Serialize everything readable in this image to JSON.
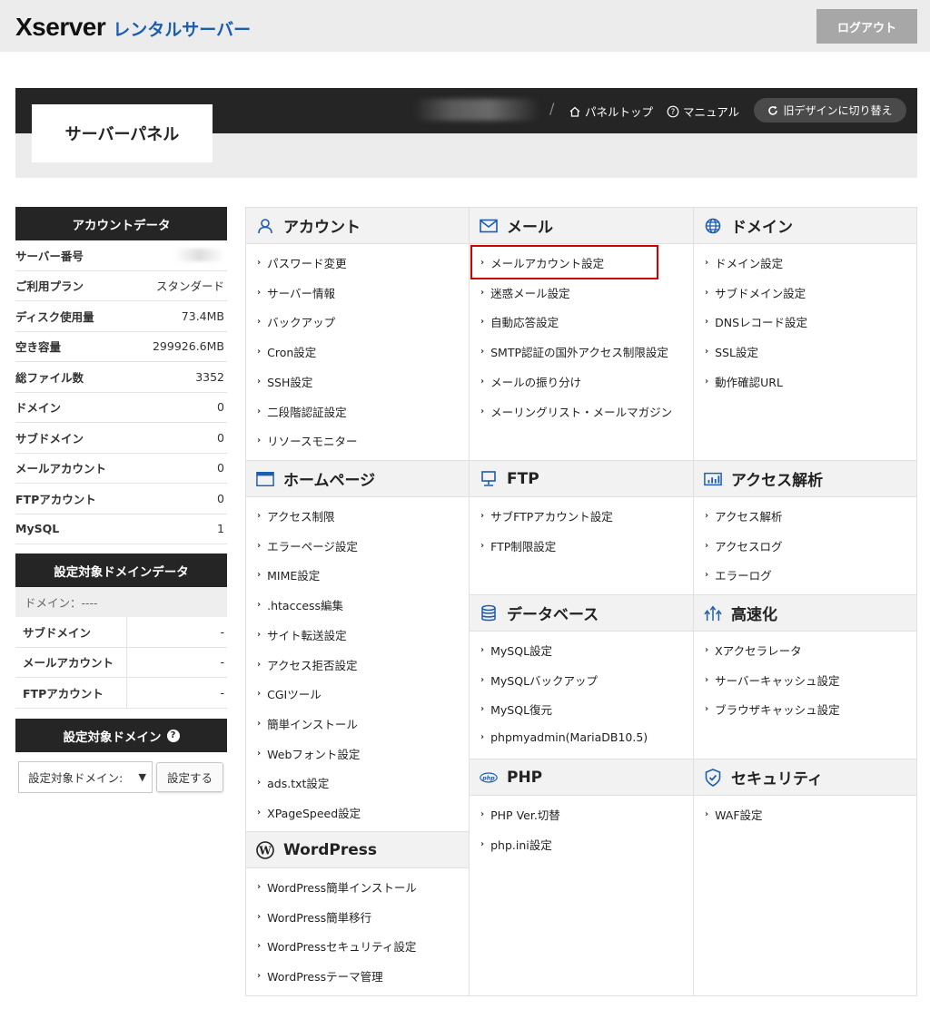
{
  "header": {
    "logo_main": "Xserver",
    "logo_sub": "レンタルサーバー",
    "logout_label": "ログアウト"
  },
  "panel": {
    "title": "サーバーパネル",
    "links": {
      "top": "パネルトップ",
      "manual": "マニュアル",
      "old_design": "旧デザインに切り替え"
    }
  },
  "account_data": {
    "title": "アカウントデータ",
    "rows": [
      {
        "k": "サーバー番号",
        "v": ""
      },
      {
        "k": "ご利用プラン",
        "v": "スタンダード"
      },
      {
        "k": "ディスク使用量",
        "v": "73.4MB"
      },
      {
        "k": "空き容量",
        "v": "299926.6MB"
      },
      {
        "k": "総ファイル数",
        "v": "3352"
      },
      {
        "k": "ドメイン",
        "v": "0"
      },
      {
        "k": "サブドメイン",
        "v": "0"
      },
      {
        "k": "メールアカウント",
        "v": "0"
      },
      {
        "k": "FTPアカウント",
        "v": "0"
      },
      {
        "k": "MySQL",
        "v": "1"
      }
    ]
  },
  "domain_data": {
    "title": "設定対象ドメインデータ",
    "domain_label": "ドメイン：----",
    "rows": [
      {
        "k": "サブドメイン",
        "v": "-"
      },
      {
        "k": "メールアカウント",
        "v": "-"
      },
      {
        "k": "FTPアカウント",
        "v": "-"
      }
    ]
  },
  "target_domain": {
    "title": "設定対象ドメイン",
    "help": "?",
    "select_value": "設定対象ドメイン:",
    "button": "設定する"
  },
  "sections": {
    "account": {
      "title": "アカウント",
      "links": [
        "パスワード変更",
        "サーバー情報",
        "バックアップ",
        "Cron設定",
        "SSH設定",
        "二段階認証設定",
        "リソースモニター"
      ]
    },
    "mail": {
      "title": "メール",
      "links": [
        "メールアカウント設定",
        "迷惑メール設定",
        "自動応答設定",
        "SMTP認証の国外アクセス制限設定",
        "メールの振り分け",
        "メーリングリスト・メールマガジン"
      ]
    },
    "domain": {
      "title": "ドメイン",
      "links": [
        "ドメイン設定",
        "サブドメイン設定",
        "DNSレコード設定",
        "SSL設定",
        "動作確認URL"
      ]
    },
    "homepage": {
      "title": "ホームページ",
      "links": [
        "アクセス制限",
        "エラーページ設定",
        "MIME設定",
        ".htaccess編集",
        "サイト転送設定",
        "アクセス拒否設定",
        "CGIツール",
        "簡単インストール",
        "Webフォント設定",
        "ads.txt設定",
        "XPageSpeed設定"
      ]
    },
    "ftp": {
      "title": "FTP",
      "links": [
        "サブFTPアカウント設定",
        "FTP制限設定"
      ]
    },
    "analytics": {
      "title": "アクセス解析",
      "links": [
        "アクセス解析",
        "アクセスログ",
        "エラーログ"
      ]
    },
    "database": {
      "title": "データベース",
      "links": [
        "MySQL設定",
        "MySQLバックアップ",
        "MySQL復元",
        "phpmyadmin(MariaDB10.5)"
      ]
    },
    "speed": {
      "title": "高速化",
      "links": [
        "Xアクセラレータ",
        "サーバーキャッシュ設定",
        "ブラウザキャッシュ設定"
      ]
    },
    "php": {
      "title": "PHP",
      "links": [
        "PHP Ver.切替",
        "php.ini設定"
      ]
    },
    "security": {
      "title": "セキュリティ",
      "links": [
        "WAF設定"
      ]
    },
    "wordpress": {
      "title": "WordPress",
      "links": [
        "WordPress簡単インストール",
        "WordPress簡単移行",
        "WordPressセキュリティ設定",
        "WordPressテーマ管理"
      ]
    }
  }
}
